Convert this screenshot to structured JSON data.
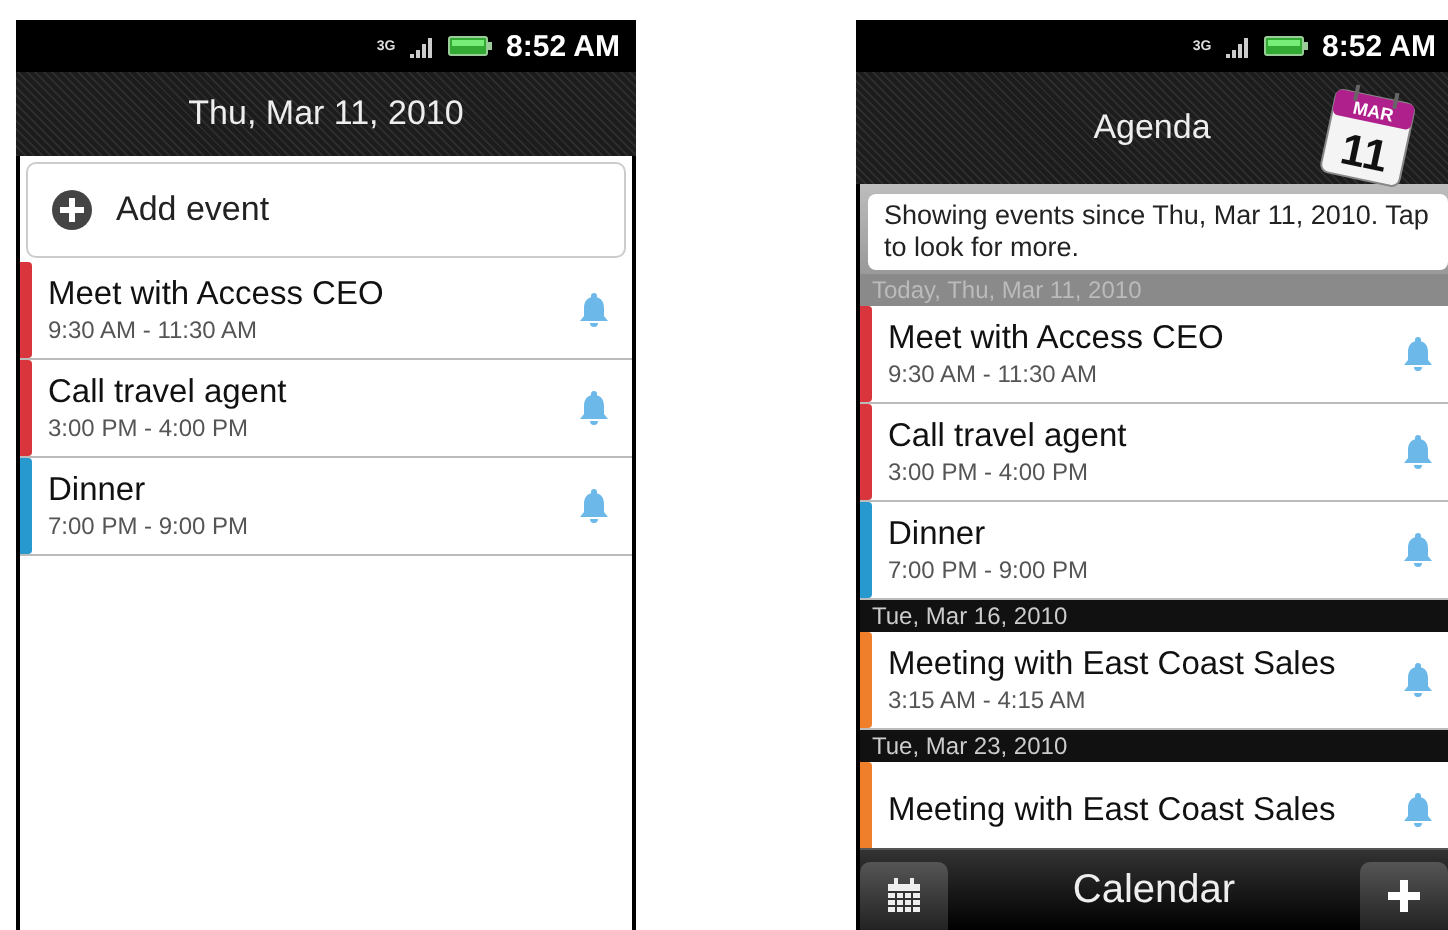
{
  "day_view": {
    "status_bar": {
      "network": "3G",
      "time": "8:52 AM"
    },
    "title": "Thu, Mar 11, 2010",
    "add_event": "Add event",
    "events": [
      {
        "title": "Meet with Access CEO",
        "time": "9:30 AM - 11:30 AM",
        "color": "#d8353c",
        "reminder": true
      },
      {
        "title": "Call travel agent",
        "time": "3:00 PM - 4:00 PM",
        "color": "#d8353c",
        "reminder": true
      },
      {
        "title": "Dinner",
        "time": "7:00 PM - 9:00 PM",
        "color": "#2799cf",
        "reminder": true
      }
    ]
  },
  "agenda": {
    "status_bar": {
      "network": "3G",
      "time": "8:52 AM"
    },
    "title": "Agenda",
    "calendar_icon": {
      "month": "MAR",
      "day": "11"
    },
    "notice": "Showing events since Thu, Mar 11, 2010. Tap to look for more.",
    "sections": [
      {
        "kind": "today",
        "date": "Today, Thu, Mar 11, 2010",
        "events": [
          {
            "title": "Meet with Access CEO",
            "time": "9:30 AM - 11:30 AM",
            "color": "#d8353c",
            "reminder": true
          },
          {
            "title": "Call travel agent",
            "time": "3:00 PM - 4:00 PM",
            "color": "#d8353c",
            "reminder": true
          },
          {
            "title": "Dinner",
            "time": "7:00 PM - 9:00 PM",
            "color": "#2799cf",
            "reminder": true
          }
        ]
      },
      {
        "kind": "future",
        "date": "Tue, Mar 16, 2010",
        "events": [
          {
            "title": "Meeting with East Coast Sales",
            "time": "3:15 AM - 4:15 AM",
            "color": "#f07f2c",
            "reminder": true
          }
        ]
      },
      {
        "kind": "future",
        "date": "Tue, Mar 23, 2010",
        "events": [
          {
            "title": "Meeting with East Coast Sales",
            "color": "#f07f2c",
            "reminder": true
          }
        ]
      }
    ],
    "bottom_bar": {
      "title": "Calendar"
    }
  }
}
